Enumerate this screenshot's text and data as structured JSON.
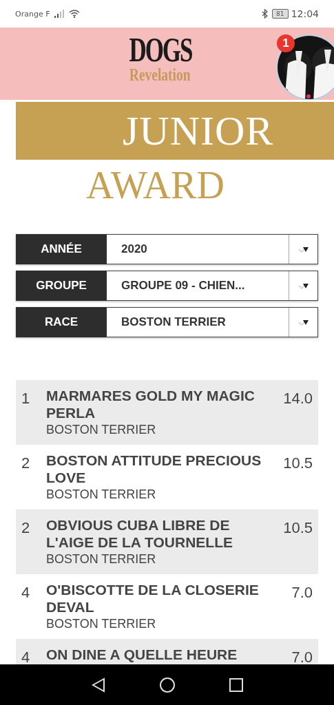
{
  "status_bar": {
    "carrier": "Orange F",
    "battery": "81",
    "time": "12:04"
  },
  "header": {
    "logo_top": "DOGS",
    "logo_bottom": "Revelation",
    "notification_count": "1"
  },
  "banner": {
    "title": "JUNIOR",
    "subtitle": "AWARD"
  },
  "filters": [
    {
      "label": "ANNÉE",
      "value": "2020"
    },
    {
      "label": "GROUPE",
      "value": "GROUPE 09 - CHIEN..."
    },
    {
      "label": "RACE",
      "value": "BOSTON TERRIER"
    }
  ],
  "rankings": [
    {
      "rank": "1",
      "name": "MARMARES GOLD MY MAGIC PERLA",
      "breed": "BOSTON TERRIER",
      "score": "14.0"
    },
    {
      "rank": "2",
      "name": "BOSTON ATTITUDE PRECIOUS LOVE",
      "breed": "BOSTON TERRIER",
      "score": "10.5"
    },
    {
      "rank": "2",
      "name": "OBVIOUS CUBA LIBRE DE L'AIGE DE LA TOURNELLE",
      "breed": "BOSTON TERRIER",
      "score": "10.5"
    },
    {
      "rank": "4",
      "name": "O'BISCOTTE DE LA CLOSERIE DEVAL",
      "breed": "BOSTON TERRIER",
      "score": "7.0"
    },
    {
      "rank": "4",
      "name": "ON DINE A QUELLE HEURE",
      "score": "7.0"
    }
  ]
}
